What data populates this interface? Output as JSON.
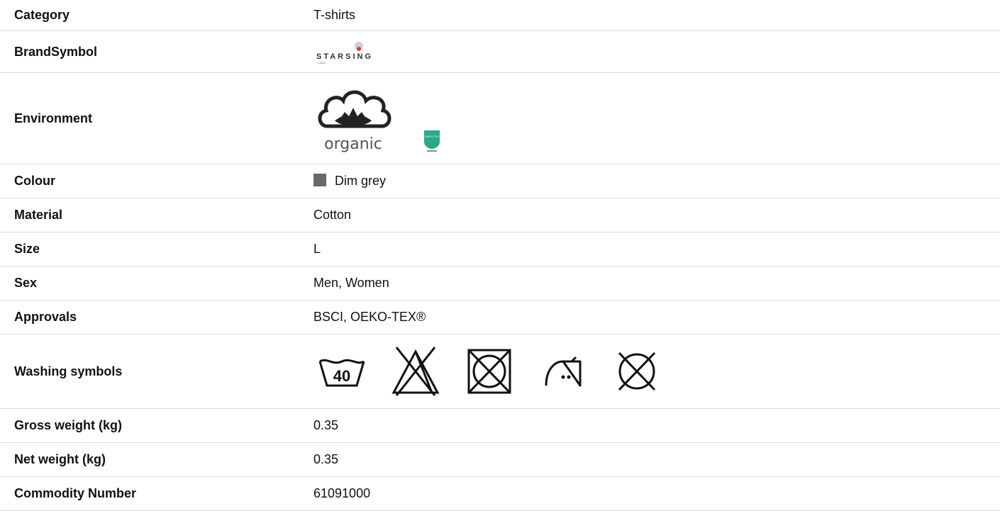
{
  "rows": {
    "category": {
      "label": "Category",
      "value": "T-shirts"
    },
    "brand": {
      "label": "BrandSymbol",
      "logo_text": "STARSING",
      "logo_sub": "LABEL"
    },
    "environment": {
      "label": "Environment",
      "organic_text": "organic",
      "badge_text": "OEKO-TEX",
      "badge_icon": "oeko-tex-badge"
    },
    "colour": {
      "label": "Colour",
      "value": "Dim grey",
      "swatch": "#696969"
    },
    "material": {
      "label": "Material",
      "value": "Cotton"
    },
    "size": {
      "label": "Size",
      "value": "L"
    },
    "sex": {
      "label": "Sex",
      "value": "Men, Women"
    },
    "approvals": {
      "label": "Approvals",
      "value": "BSCI, OEKO-TEX®"
    },
    "washing": {
      "label": "Washing symbols",
      "temp": "40",
      "icons": [
        "wash-40-icon",
        "no-bleach-icon",
        "no-tumble-dry-icon",
        "iron-medium-icon",
        "no-dry-clean-icon"
      ]
    },
    "gross": {
      "label": "Gross weight (kg)",
      "value": "0.35"
    },
    "net": {
      "label": "Net weight (kg)",
      "value": "0.35"
    },
    "commodity": {
      "label": "Commodity Number",
      "value": "61091000"
    }
  }
}
